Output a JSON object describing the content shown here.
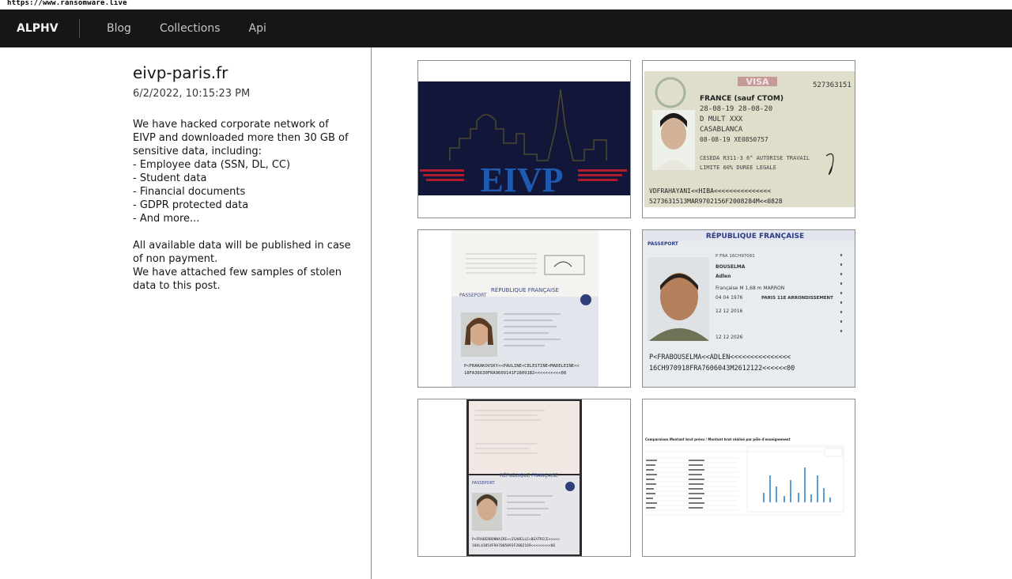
{
  "url_bar": "https://www.ransomware.live",
  "nav": {
    "brand": "ALPHV",
    "items": [
      {
        "label": "Blog"
      },
      {
        "label": "Collections"
      },
      {
        "label": "Api"
      }
    ]
  },
  "post": {
    "title": "eivp-paris.fr",
    "date": "6/2/2022, 10:15:23 PM",
    "description": "We have hacked corporate network of EIVP and downloaded more then 30 GB of sensitive data, including:\n- Employee data (SSN, DL, CC)\n- Student data\n- Financial documents\n- GDPR protected data\n- And more...\n\nAll available data will be published in case of non payment.\nWe have attached few samples of stolen data to this post."
  },
  "images": [
    {
      "name": "eivp-logo-image",
      "logo_text": "EIVP"
    },
    {
      "name": "visa-image",
      "text": [
        "VISA",
        "FRANCE (sauf CTOM)",
        "CASABLANCA"
      ]
    },
    {
      "name": "passport-1-image",
      "text": [
        "RÉPUBLIQUE FRANÇAISE",
        "PASSEPORT"
      ]
    },
    {
      "name": "passport-2-image",
      "text": [
        "RÉPUBLIQUE FRANÇAISE",
        "PASSEPORT",
        "BOUSELMA",
        "Adlen",
        "PARIS 11E ARRONDISSEMENT"
      ]
    },
    {
      "name": "passport-3-image",
      "text": [
        "RÉPUBLIQUE FRANÇAISE",
        "PASSEPORT"
      ]
    },
    {
      "name": "spreadsheet-image",
      "text": [
        "Comparaison Montant brut prévu / Montant brut réalisé par pôle d'enseignement"
      ]
    }
  ],
  "colors": {
    "nav_bg": "#161616",
    "logo_bg": "#12173a",
    "logo_blue": "#1e5bb0",
    "logo_red": "#b01c2e"
  }
}
